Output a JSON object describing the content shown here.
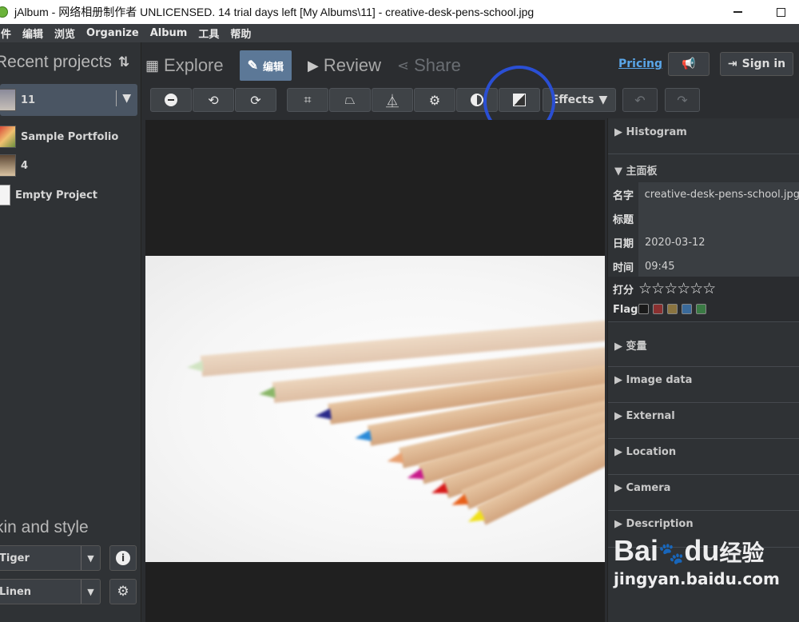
{
  "window": {
    "title": "jAlbum - 网络相册制作者 UNLICENSED. 14 trial days left [My Albums\\11] - creative-desk-pens-school.jpg"
  },
  "menu": [
    "件",
    "编辑",
    "浏览",
    "Organize",
    "Album",
    "工具",
    "帮助"
  ],
  "left_panel": {
    "recent_title": "Recent projects",
    "projects": [
      {
        "name": "11",
        "selected": true
      },
      {
        "name": "Sample Portfolio",
        "selected": false
      },
      {
        "name": "4",
        "selected": false
      },
      {
        "name": "Empty Project",
        "selected": false
      }
    ],
    "skin_title": "kin and style",
    "skin_value": "Tiger",
    "style_value": "Linen"
  },
  "mode_tabs": {
    "explore": "Explore",
    "edit": "编辑",
    "review": "Review",
    "share": "Share"
  },
  "header": {
    "pricing": "Pricing",
    "sign_in": "Sign in"
  },
  "toolbar": {
    "effects": "Effects"
  },
  "right_panel": {
    "histogram": "Histogram",
    "main_panel": "主面板",
    "props": {
      "name_label": "名字",
      "name_value": "creative-desk-pens-school.jpg",
      "title_label": "标题",
      "title_value": "",
      "date_label": "日期",
      "date_value": "2020-03-12",
      "time_label": "时间",
      "time_value": "09:45",
      "rating_label": "打分",
      "rating_value": "☆☆☆☆☆☆",
      "flag_label": "Flag"
    },
    "flag_colors": [
      "#1a1a1a",
      "#8a3030",
      "#8a7440",
      "#3a6a9a",
      "#3a7a44"
    ],
    "sections": [
      "变量",
      "Image data",
      "External",
      "Location",
      "Camera",
      "Description"
    ]
  },
  "watermark": {
    "logo": "Bai",
    "logo_mid": "du",
    "logo_cn": "经验",
    "url": "jingyan.baidu.com"
  },
  "colors": {
    "accent_blue": "#5c7897",
    "link": "#5aa6e8",
    "highlight": "#2a4fd4"
  }
}
